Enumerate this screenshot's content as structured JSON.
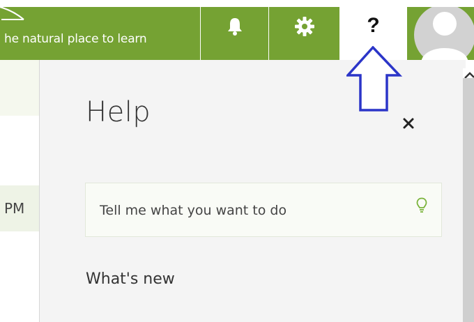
{
  "header": {
    "tagline": "he natural place to learn",
    "notifications_icon": "bell-icon",
    "settings_icon": "gear-icon",
    "help_label": "?",
    "avatar_icon": "user-avatar-icon"
  },
  "background": {
    "time_fragment": "PM"
  },
  "help_panel": {
    "title": "Help",
    "close_icon": "close-icon",
    "search_placeholder": "Tell me what you want to do",
    "search_value": "",
    "search_icon": "lightbulb-icon",
    "whats_new": "What's new"
  },
  "colors": {
    "brand_green": "#75a233",
    "panel_bg": "#f4f4f4",
    "arrow_blue": "#2b35c8",
    "bulb_green": "#7ab33a"
  }
}
